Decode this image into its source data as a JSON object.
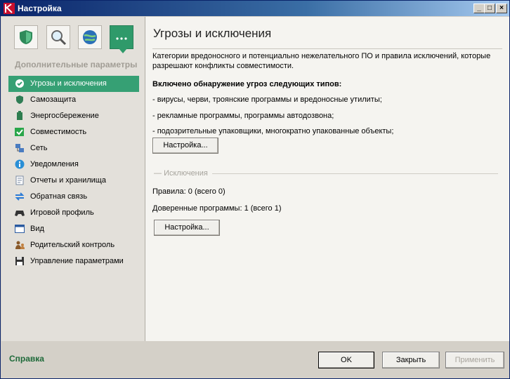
{
  "window": {
    "title": "Настройка"
  },
  "sidebar": {
    "heading": "Дополнительные параметры",
    "items": [
      {
        "label": "Угрозы и исключения",
        "icon": "shield-check-icon",
        "active": true
      },
      {
        "label": "Самозащита",
        "icon": "shield-icon"
      },
      {
        "label": "Энергосбережение",
        "icon": "battery-icon"
      },
      {
        "label": "Совместимость",
        "icon": "checkbox-icon"
      },
      {
        "label": "Сеть",
        "icon": "network-icon"
      },
      {
        "label": "Уведомления",
        "icon": "info-icon"
      },
      {
        "label": "Отчеты и хранилища",
        "icon": "report-icon"
      },
      {
        "label": "Обратная связь",
        "icon": "feedback-arrows-icon"
      },
      {
        "label": "Игровой профиль",
        "icon": "gamepad-icon"
      },
      {
        "label": "Вид",
        "icon": "view-icon"
      },
      {
        "label": "Родительский контроль",
        "icon": "parental-control-icon"
      },
      {
        "label": "Управление параметрами",
        "icon": "floppy-disk-icon"
      }
    ]
  },
  "content": {
    "title": "Угрозы и исключения",
    "description": "Категории вредоносного и потенциально нежелательного ПО и правила исключений, которые разрешают конфликты совместимости.",
    "threats_title": "Включено обнаружение угроз следующих типов:",
    "threat_lines": [
      "- вирусы, черви, троянские программы и вредоносные утилиты;",
      "- рекламные программы, программы автодозвона;",
      "- подозрительные упаковщики, многократно упакованные объекты;"
    ],
    "settings_button": "Настройка...",
    "exclusions_heading": "Исключения",
    "rules": "Правила: 0 (всего 0)",
    "trusted": "Доверенные программы: 1 (всего 1)",
    "exclusions_settings_button": "Настройка..."
  },
  "footer": {
    "help": "Справка",
    "ok": "OK",
    "close": "Закрыть",
    "apply": "Применить"
  },
  "colors": {
    "accent": "#36a074",
    "title_bar": "#0a246a",
    "help_link": "#1f6a3a"
  }
}
